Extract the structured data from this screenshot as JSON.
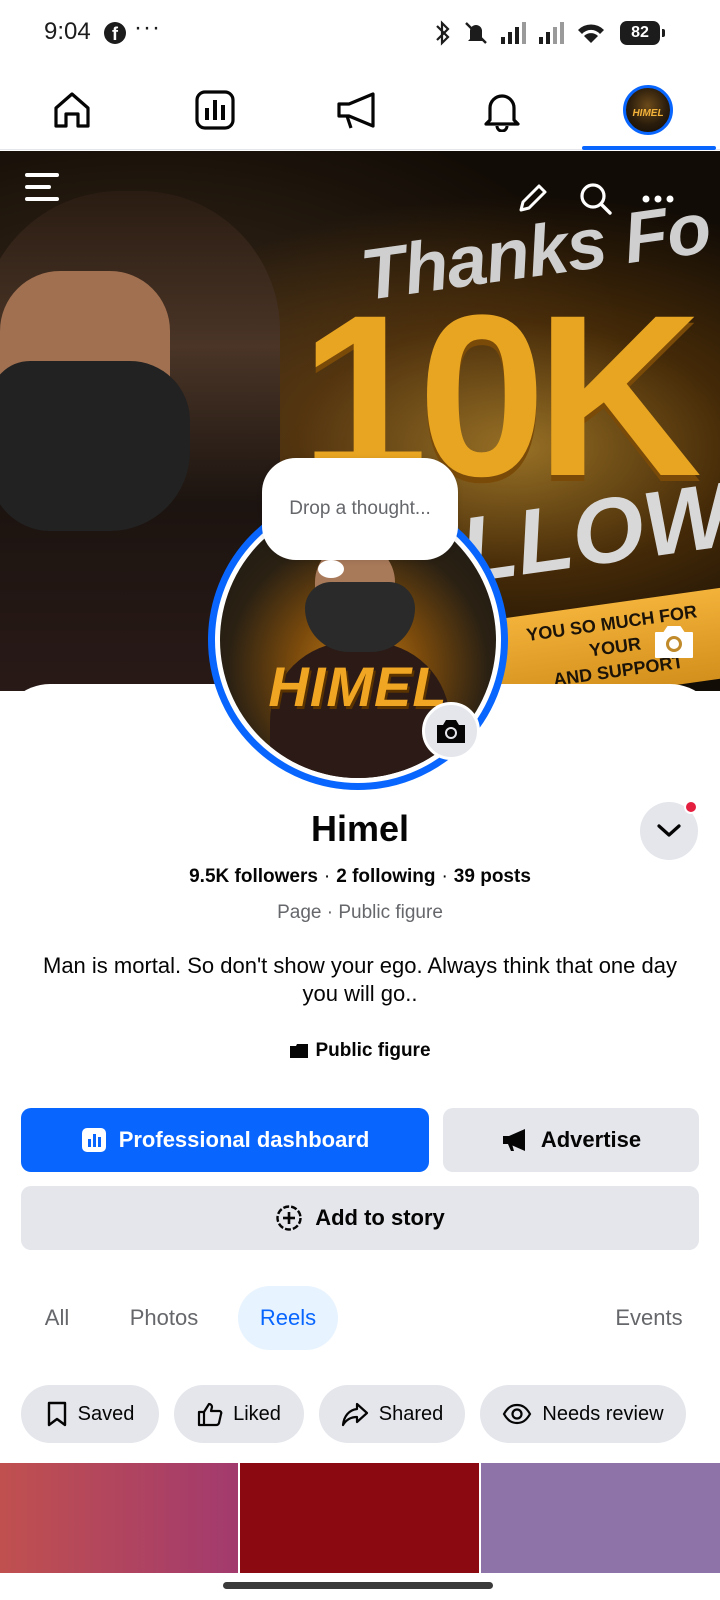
{
  "status_bar": {
    "time": "9:04",
    "fb_glyph": "f",
    "more": "···",
    "battery": "82"
  },
  "top_nav": {
    "items": [
      "home-icon",
      "dashboard-icon",
      "megaphone-icon",
      "bell-icon",
      "profile-avatar"
    ],
    "active": "profile-avatar",
    "avatar_text": "HIMEL"
  },
  "cover": {
    "headline": "Thanks Fo",
    "big_text": "10K",
    "sub_text": "LLOW",
    "ribbon_text": "YOU SO MUCH FOR YOUR\nAND SUPPORT"
  },
  "profile": {
    "thought_placeholder": "Drop a thought...",
    "picture_text": "HIMEL",
    "name": "Himel",
    "followers": "9.5K followers",
    "following": "2 following",
    "posts": "39 posts",
    "separator": "·",
    "category": "Page · Public figure",
    "bio": "Man is mortal. So don't show your ego. Always think that one day you will go..",
    "public_figure": "Public figure"
  },
  "actions": {
    "dashboard": "Professional dashboard",
    "advertise": "Advertise",
    "add_story": "Add to story"
  },
  "tabs": {
    "all": "All",
    "photos": "Photos",
    "reels": "Reels",
    "events": "Events",
    "active": "Reels"
  },
  "chips": {
    "saved": "Saved",
    "liked": "Liked",
    "shared": "Shared",
    "needs_review": "Needs review"
  },
  "colors": {
    "accent": "#0866ff",
    "secondary_bg": "#e4e6eb",
    "notification": "#e41e3f",
    "thumb_1": "#b04a68",
    "thumb_2": "#8b0a12",
    "thumb_3": "#8e73a8"
  }
}
